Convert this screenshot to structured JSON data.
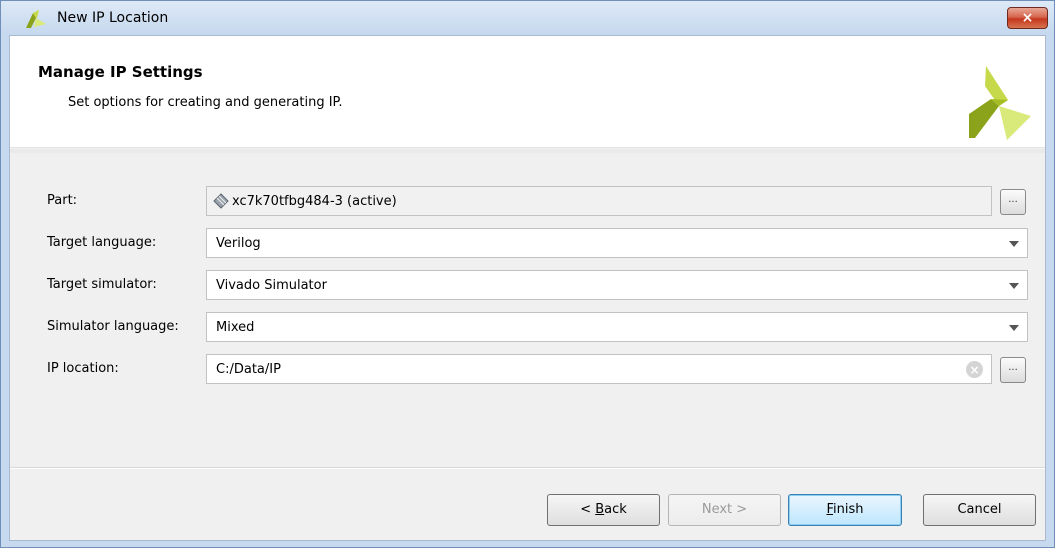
{
  "window": {
    "title": "New IP Location",
    "close_label": "×"
  },
  "header": {
    "title": "Manage IP Settings",
    "subtitle": "Set options for creating and generating IP."
  },
  "form": {
    "part": {
      "label": "Part:",
      "value": "xc7k70tfbg484-3 (active)",
      "browse_label": "..."
    },
    "target_language": {
      "label": "Target language:",
      "value": "Verilog"
    },
    "target_simulator": {
      "label": "Target simulator:",
      "value": "Vivado Simulator"
    },
    "simulator_language": {
      "label": "Simulator language:",
      "value": "Mixed"
    },
    "ip_location": {
      "label": "IP location:",
      "value": "C:/Data/IP",
      "browse_label": "..."
    }
  },
  "buttons": {
    "back": {
      "prefix": "< ",
      "mnemonic": "B",
      "rest": "ack"
    },
    "next": {
      "label": "Next >"
    },
    "finish": {
      "mnemonic": "F",
      "rest": "inish"
    },
    "cancel": {
      "label": "Cancel"
    }
  },
  "colors": {
    "logo_green_dark": "#8aa31a",
    "logo_green_light": "#d9ea7a",
    "window_frame": "#c7d9ee",
    "close_red": "#c4371e"
  },
  "icons": {
    "app_logo": "vivado-logo-icon",
    "part_chip": "chip-icon",
    "clear": "clear-icon",
    "dropdown": "chevron-down-icon"
  }
}
